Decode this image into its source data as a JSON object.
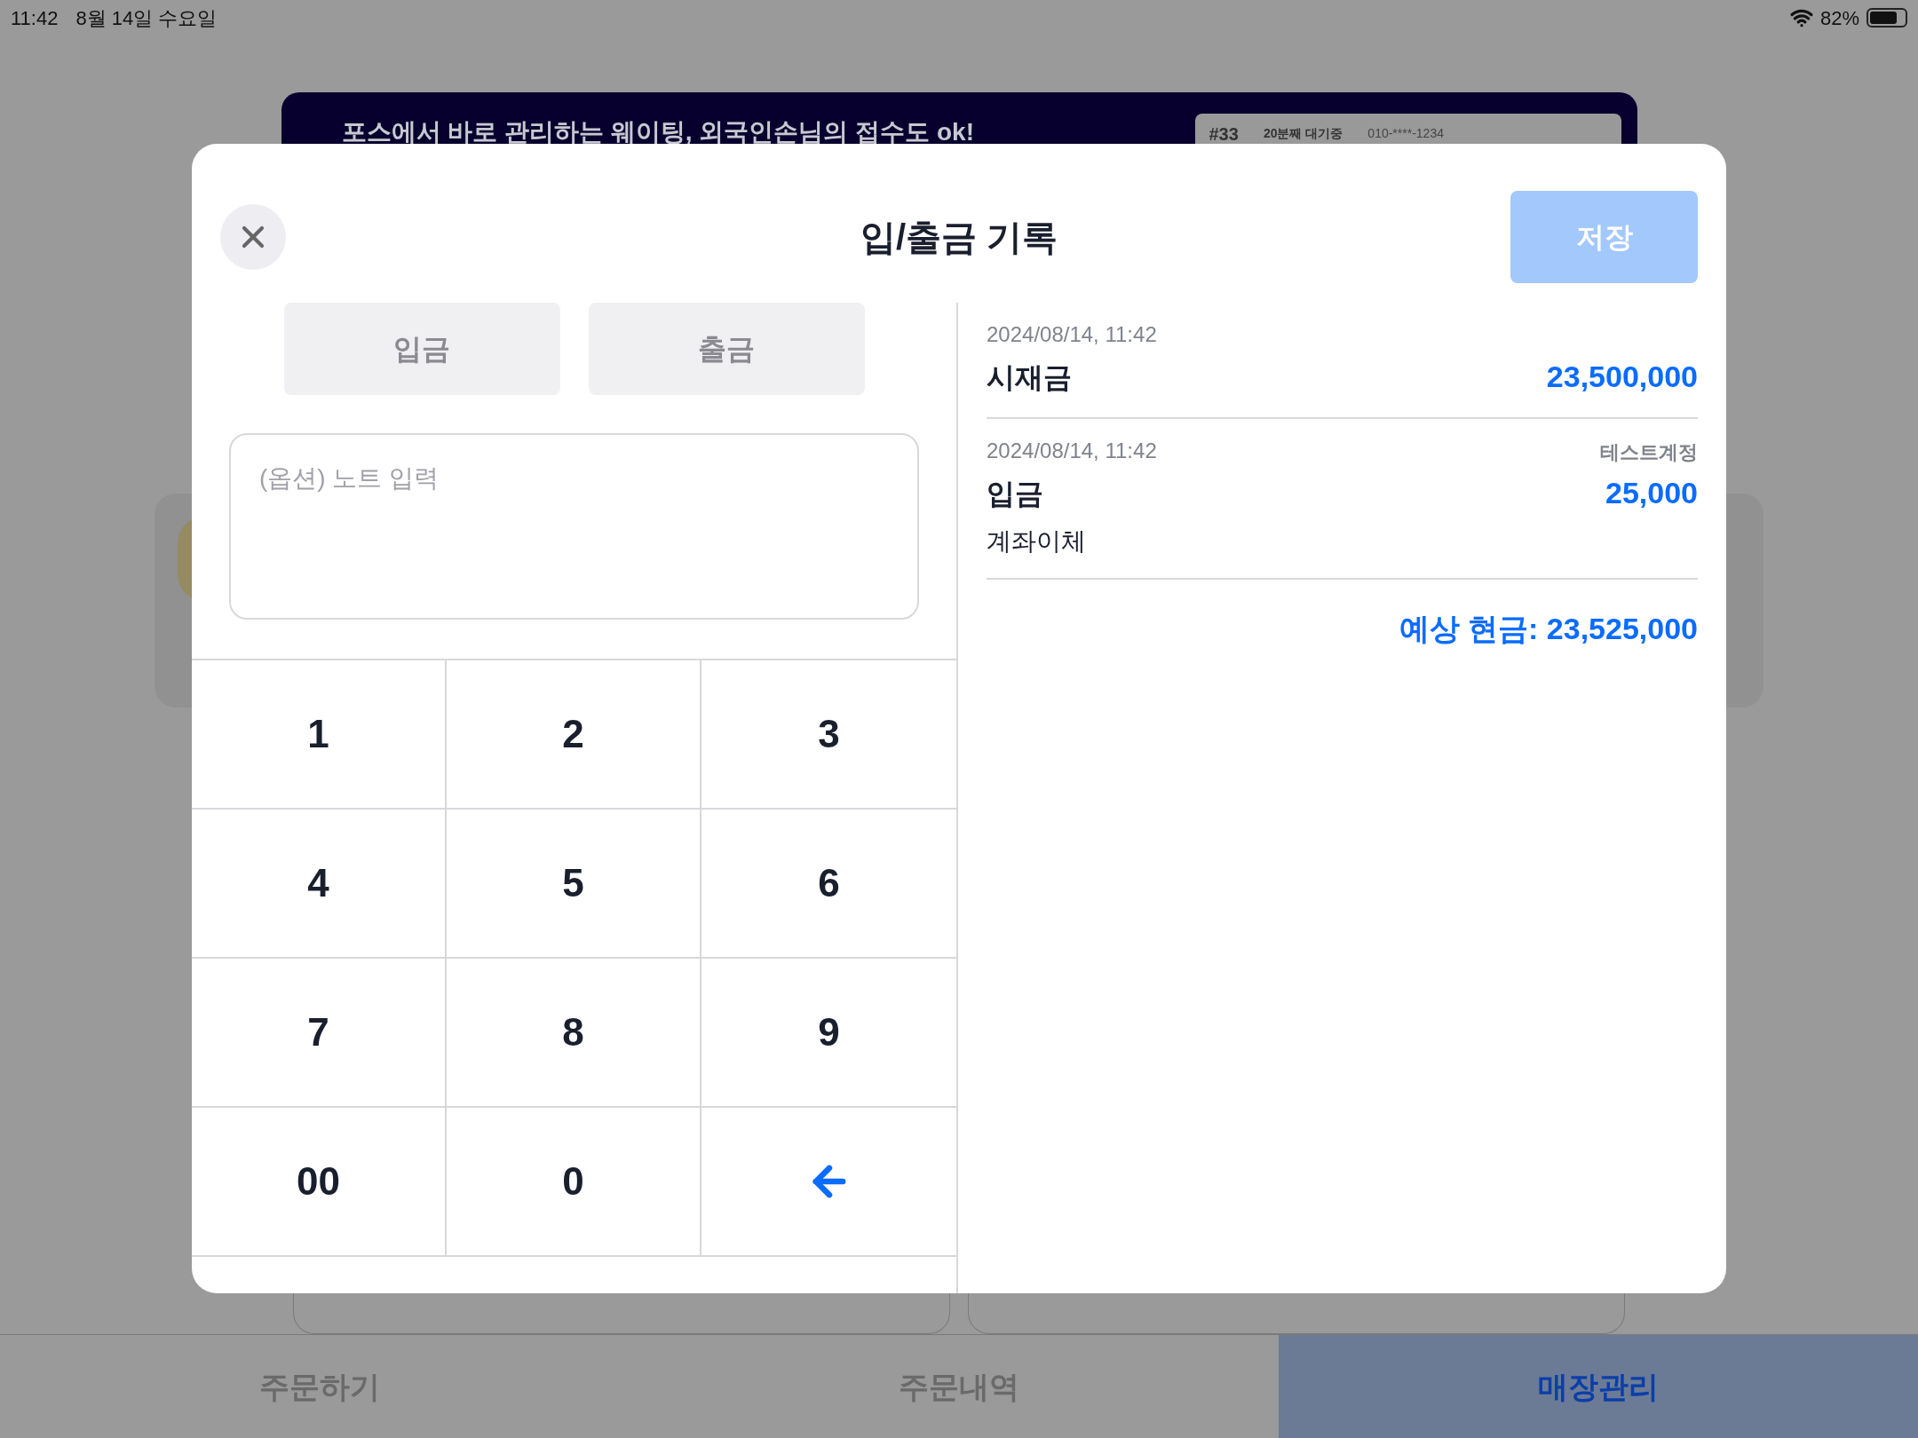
{
  "status_bar": {
    "time": "11:42",
    "date": "8월 14일 수요일",
    "battery": "82%"
  },
  "background": {
    "banner": {
      "text": "포스에서 바로 관리하는 웨이팅, 외국인손님의 접수도 ok!",
      "ticket": {
        "number": "#33",
        "wait": "20분째 대기중",
        "phone": "010-****-1234"
      }
    }
  },
  "modal": {
    "title": "입/출금 기록",
    "save_button": "저장",
    "type_tabs": [
      {
        "label": "입금",
        "selected": false
      },
      {
        "label": "출금",
        "selected": false
      }
    ],
    "note": {
      "placeholder": "(옵션) 노트 입력"
    },
    "keypad": [
      {
        "kind": "key",
        "label": "1"
      },
      {
        "kind": "key",
        "label": "2"
      },
      {
        "kind": "key",
        "label": "3"
      },
      {
        "kind": "key",
        "label": "4"
      },
      {
        "kind": "key",
        "label": "5"
      },
      {
        "kind": "key",
        "label": "6"
      },
      {
        "kind": "key",
        "label": "7"
      },
      {
        "kind": "key",
        "label": "8"
      },
      {
        "kind": "key",
        "label": "9"
      },
      {
        "kind": "key",
        "label": "00"
      },
      {
        "kind": "key",
        "label": "0"
      },
      {
        "kind": "backspace"
      }
    ],
    "records": [
      {
        "time": "2024/08/14, 11:42",
        "type": "시재금",
        "amount": "23,500,000"
      },
      {
        "time": "2024/08/14, 11:42",
        "account": "테스트계정",
        "type": "입금",
        "amount": "25,000",
        "method": "계좌이체"
      }
    ],
    "expected_cash": "예상 현금: 23,525,000"
  },
  "bottom_tabs": [
    {
      "label": "주문하기",
      "selected": false
    },
    {
      "label": "주문내역",
      "selected": false
    },
    {
      "label": "매장관리",
      "selected": true
    }
  ]
}
